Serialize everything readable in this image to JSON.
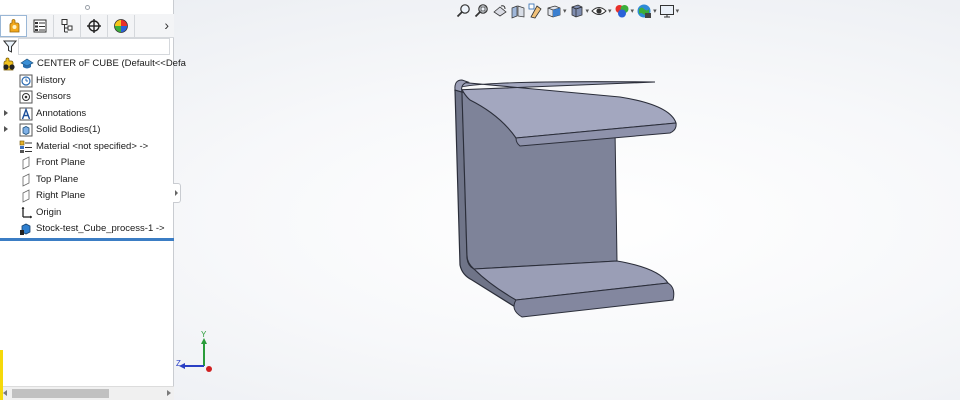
{
  "feature_tree": {
    "root_label": "CENTER oF CUBE  (Default<<Defa",
    "items": [
      {
        "label": "History",
        "icon": "history-icon",
        "expandable": false
      },
      {
        "label": "Sensors",
        "icon": "sensors-icon",
        "expandable": false
      },
      {
        "label": "Annotations",
        "icon": "annotations-icon",
        "expandable": true
      },
      {
        "label": "Solid Bodies(1)",
        "icon": "solid-bodies-icon",
        "expandable": true
      },
      {
        "label": "Material <not specified> ->",
        "icon": "material-icon",
        "expandable": false
      },
      {
        "label": "Front Plane",
        "icon": "plane-icon",
        "expandable": false
      },
      {
        "label": "Top Plane",
        "icon": "plane-icon",
        "expandable": false
      },
      {
        "label": "Right Plane",
        "icon": "plane-icon",
        "expandable": false
      },
      {
        "label": "Origin",
        "icon": "origin-icon",
        "expandable": false
      },
      {
        "label": "Stock-test_Cube_process-1 ->",
        "icon": "part-icon",
        "expandable": false
      }
    ]
  },
  "tabs": [
    {
      "name": "featuremanager-tab",
      "icon": "featuremanager-icon",
      "active": true
    },
    {
      "name": "propertymanager-tab",
      "icon": "propertymanager-icon",
      "active": false
    },
    {
      "name": "configurationmanager-tab",
      "icon": "configurationmanager-icon",
      "active": false
    },
    {
      "name": "dimxpert-tab",
      "icon": "dimxpert-icon",
      "active": false
    },
    {
      "name": "display-manager-tab",
      "icon": "display-manager-icon",
      "active": false
    }
  ],
  "tabs_more_glyph": "›",
  "heads_up_toolbar": [
    "zoom-to-fit-icon",
    "zoom-to-area-icon",
    "previous-view-icon",
    "section-view-icon",
    "dynamic-annotation-icon",
    "view-orientation-icon",
    "display-style-icon",
    "hide-show-items-icon",
    "edit-appearance-icon",
    "apply-scene-icon",
    "view-settings-icon"
  ],
  "triad": {
    "y_label": "Y",
    "z_label": "Z"
  },
  "colors": {
    "accent": "#3b7dc4",
    "model_face": "#8a8fa8",
    "model_top": "#a3a7bf",
    "triad_y": "#2a9c3a",
    "triad_x": "#d02020",
    "triad_z": "#2a3fc4"
  }
}
